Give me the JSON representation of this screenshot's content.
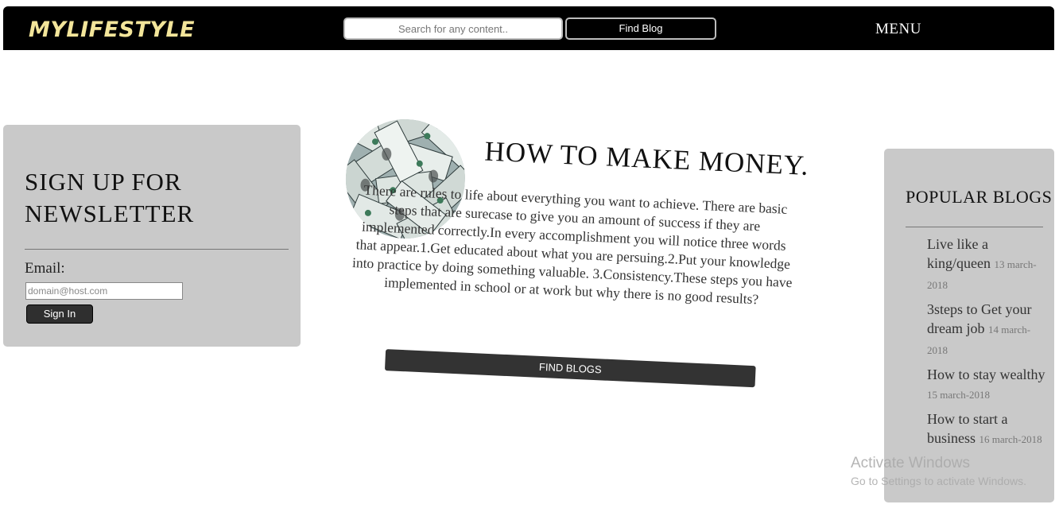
{
  "header": {
    "logo": "MYLIFESTYLE",
    "search_placeholder": "Search for any content..",
    "find_blog_label": "Find Blog",
    "menu_label": "MENU"
  },
  "newsletter": {
    "title": "SIGN UP FOR NEWSLETTER",
    "email_label": "Email:",
    "email_placeholder": "domain@host.com",
    "signin_label": "Sign In"
  },
  "article": {
    "image": "money-bills-image",
    "title": "HOW TO MAKE MONEY.",
    "body": "There are rules to life about everything you want to achieve. There are basic steps that are surecase to give you an amount of success if they are implemented correctly.In every accomplishment you will notice three words that appear.1.Get educated about what you are persuing.2.Put your knowledge into practice by doing something valuable. 3.Consistency.These steps you have implemented in school or at work but why there is no good results?",
    "cta_label": "FIND BLOGS"
  },
  "popular": {
    "title": "POPULAR BLOGS",
    "items": [
      {
        "title": "Live like a king/queen",
        "date": "13 march-2018"
      },
      {
        "title": "3steps to Get your dream job",
        "date": "14 march-2018"
      },
      {
        "title": "How to stay wealthy",
        "date": "15 march-2018"
      },
      {
        "title": "How to start a business",
        "date": "16 march-2018"
      }
    ]
  },
  "watermark": {
    "title": "Activate Windows",
    "subtitle": "Go to Settings to activate Windows."
  },
  "colors": {
    "nav_bg": "#000000",
    "logo": "#f3e59a",
    "panel_bg": "#c9c9c9",
    "button_dark": "#333333"
  }
}
